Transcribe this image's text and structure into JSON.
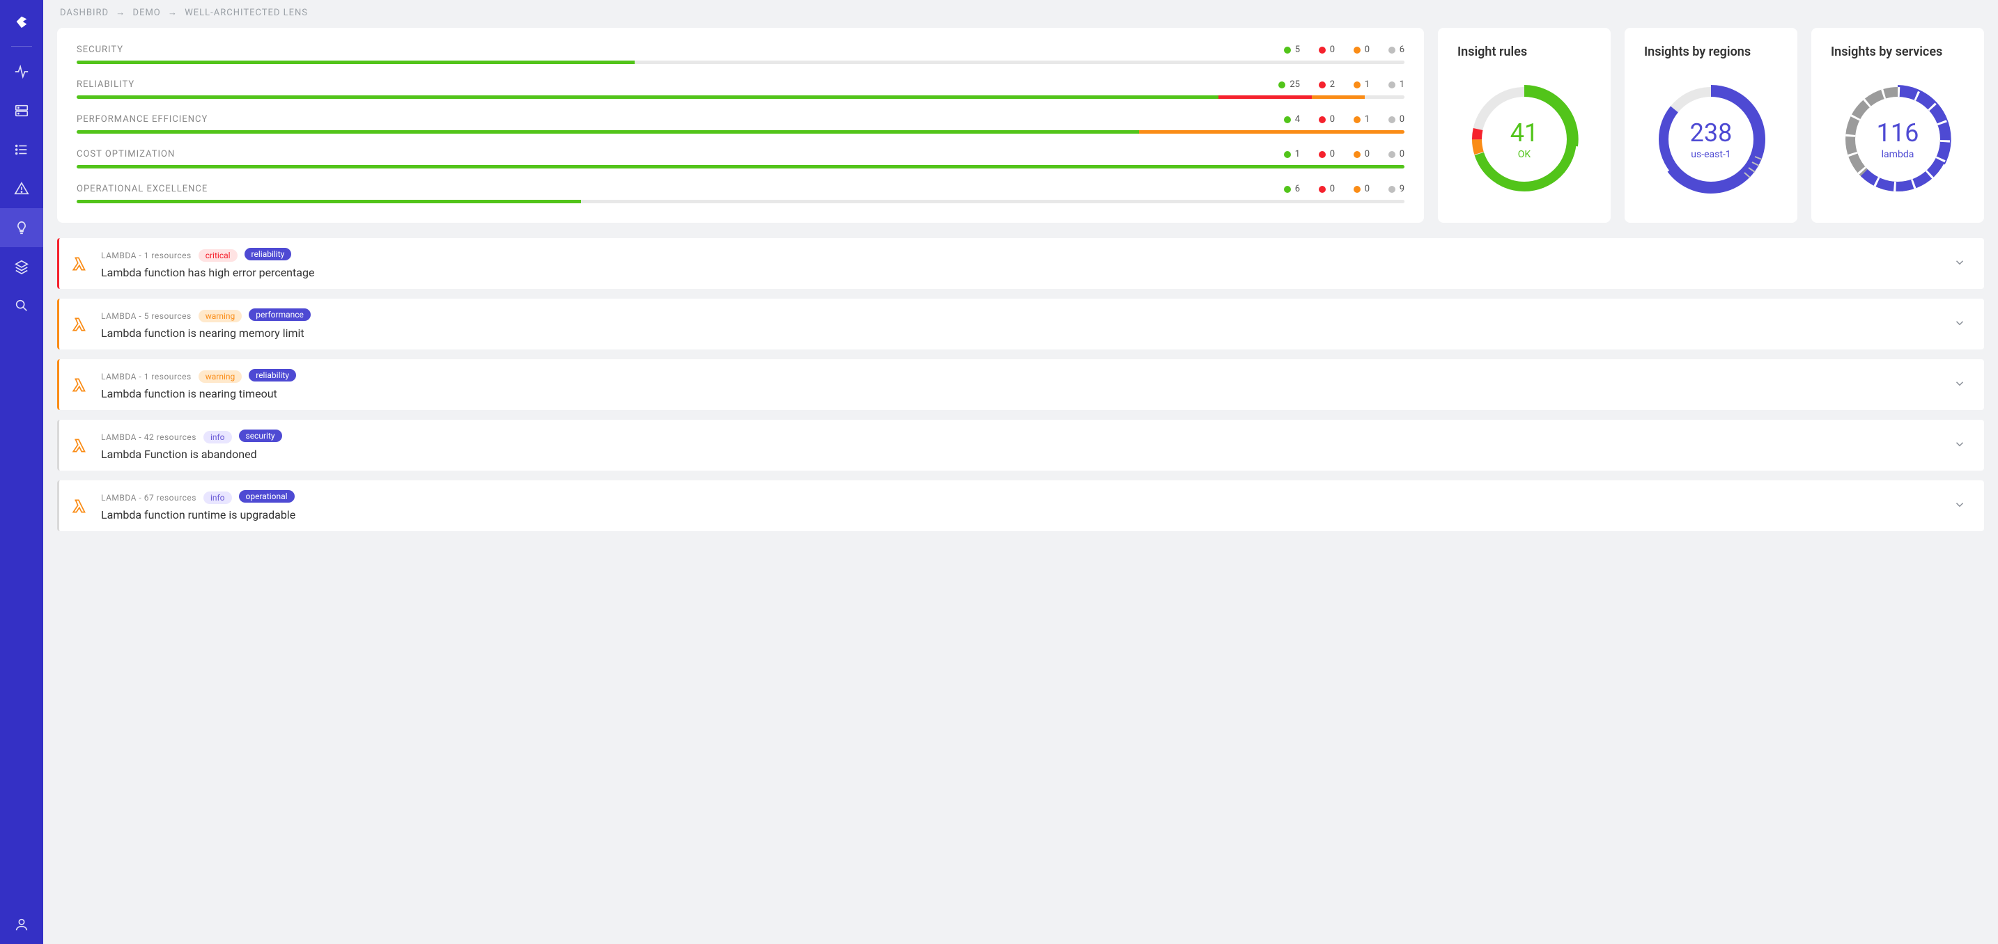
{
  "breadcrumb": [
    "DASHBIRD",
    "DEMO",
    "WELL-ARCHITECTED LENS"
  ],
  "pillars": [
    {
      "name": "SECURITY",
      "ok": 5,
      "critical": 0,
      "warning": 0,
      "info": 6,
      "bar": {
        "green": 42,
        "red": 0,
        "orange": 0,
        "gray": 58
      }
    },
    {
      "name": "RELIABILITY",
      "ok": 25,
      "critical": 2,
      "warning": 1,
      "info": 1,
      "bar": {
        "green": 86,
        "red": 7,
        "orange": 4,
        "gray": 3
      }
    },
    {
      "name": "PERFORMANCE EFFICIENCY",
      "ok": 4,
      "critical": 0,
      "warning": 1,
      "info": 0,
      "bar": {
        "green": 80,
        "red": 0,
        "orange": 20,
        "gray": 0
      }
    },
    {
      "name": "COST OPTIMIZATION",
      "ok": 1,
      "critical": 0,
      "warning": 0,
      "info": 0,
      "bar": {
        "green": 100,
        "red": 0,
        "orange": 0,
        "gray": 0
      }
    },
    {
      "name": "OPERATIONAL EXCELLENCE",
      "ok": 6,
      "critical": 0,
      "warning": 0,
      "info": 9,
      "bar": {
        "green": 38,
        "red": 0,
        "orange": 0,
        "gray": 62
      }
    }
  ],
  "gauges": {
    "rules": {
      "title": "Insight rules",
      "value": "41",
      "sub": "OK",
      "colorClass": "c-green"
    },
    "regions": {
      "title": "Insights by regions",
      "value": "238",
      "sub": "us-east-1",
      "colorClass": "c-blue"
    },
    "services": {
      "title": "Insights by services",
      "value": "116",
      "sub": "lambda",
      "colorClass": "c-blue"
    }
  },
  "chart_data": [
    {
      "type": "bar",
      "title": "SECURITY",
      "categories": [
        "ok",
        "critical",
        "warning",
        "info"
      ],
      "values": [
        5,
        0,
        0,
        6
      ]
    },
    {
      "type": "bar",
      "title": "RELIABILITY",
      "categories": [
        "ok",
        "critical",
        "warning",
        "info"
      ],
      "values": [
        25,
        2,
        1,
        1
      ]
    },
    {
      "type": "bar",
      "title": "PERFORMANCE EFFICIENCY",
      "categories": [
        "ok",
        "critical",
        "warning",
        "info"
      ],
      "values": [
        4,
        0,
        1,
        0
      ]
    },
    {
      "type": "bar",
      "title": "COST OPTIMIZATION",
      "categories": [
        "ok",
        "critical",
        "warning",
        "info"
      ],
      "values": [
        1,
        0,
        0,
        0
      ]
    },
    {
      "type": "bar",
      "title": "OPERATIONAL EXCELLENCE",
      "categories": [
        "ok",
        "critical",
        "warning",
        "info"
      ],
      "values": [
        6,
        0,
        0,
        9
      ]
    },
    {
      "type": "pie",
      "title": "Insight rules",
      "series": [
        {
          "name": "OK",
          "value": 41
        },
        {
          "name": "critical",
          "value": 2
        },
        {
          "name": "warning",
          "value": 2
        },
        {
          "name": "other",
          "value": 16
        }
      ]
    },
    {
      "type": "pie",
      "title": "Insights by regions",
      "series": [
        {
          "name": "us-east-1",
          "value": 238
        },
        {
          "name": "other",
          "value": 40
        }
      ]
    },
    {
      "type": "pie",
      "title": "Insights by services",
      "series": [
        {
          "name": "lambda",
          "value": 116
        },
        {
          "name": "other",
          "value": 70
        }
      ]
    }
  ],
  "insights": [
    {
      "service": "LAMBDA",
      "resources": "1 resources",
      "severity": "critical",
      "severityClass": "critical",
      "pillar": "reliability",
      "title": "Lambda function has high error percentage",
      "border": "critical-border"
    },
    {
      "service": "LAMBDA",
      "resources": "5 resources",
      "severity": "warning",
      "severityClass": "warning",
      "pillar": "performance",
      "title": "Lambda function is nearing memory limit",
      "border": "warning-border"
    },
    {
      "service": "LAMBDA",
      "resources": "1 resources",
      "severity": "warning",
      "severityClass": "warning",
      "pillar": "reliability",
      "title": "Lambda function is nearing timeout",
      "border": "warning-border"
    },
    {
      "service": "LAMBDA",
      "resources": "42 resources",
      "severity": "info",
      "severityClass": "info",
      "pillar": "security",
      "title": "Lambda Function is abandoned",
      "border": "info-border"
    },
    {
      "service": "LAMBDA",
      "resources": "67 resources",
      "severity": "info",
      "severityClass": "info",
      "pillar": "operational",
      "title": "Lambda function runtime is upgradable",
      "border": "info-border"
    }
  ]
}
